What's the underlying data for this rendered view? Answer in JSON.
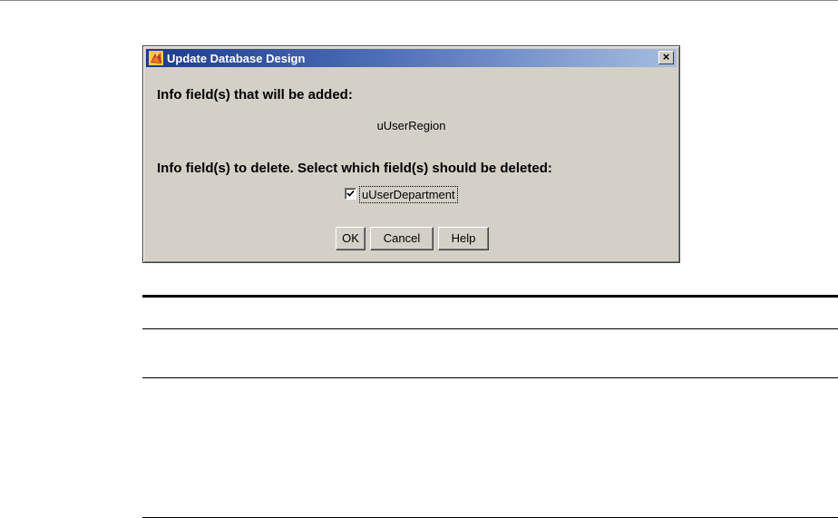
{
  "dialog": {
    "title": "Update Database Design",
    "close_label": "×",
    "added_heading": "Info field(s) that will be added:",
    "added_fields": [
      "uUserRegion"
    ],
    "delete_heading": "Info field(s) to delete. Select which field(s) should be deleted:",
    "delete_fields": [
      {
        "label": "uUserDepartment",
        "checked": true
      }
    ],
    "buttons": {
      "ok": "OK",
      "cancel": "Cancel",
      "help": "Help"
    }
  }
}
